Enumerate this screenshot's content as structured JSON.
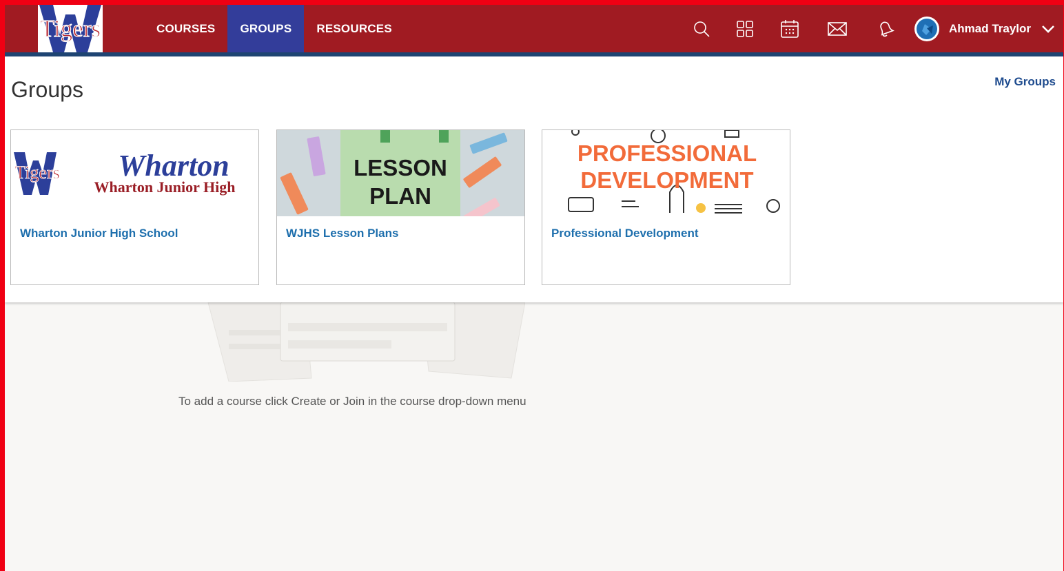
{
  "header": {
    "logo_text": "Tigers",
    "nav": [
      {
        "label": "COURSES"
      },
      {
        "label": "GROUPS",
        "active": true
      },
      {
        "label": "RESOURCES"
      }
    ],
    "icons": [
      "search-icon",
      "apps-grid-icon",
      "calendar-icon",
      "mail-icon",
      "bell-icon"
    ],
    "user_name": "Ahmad Traylor"
  },
  "page": {
    "title": "Groups",
    "my_groups_link": "My Groups"
  },
  "groups": [
    {
      "title": "Wharton Junior High School",
      "image_text": [
        "Tigers",
        "Wharton",
        "Wharton Junior High"
      ]
    },
    {
      "title": "WJHS Lesson Plans",
      "image_text": [
        "LESSON",
        "PLAN"
      ]
    },
    {
      "title": "Professional Development",
      "image_text": [
        "PROFESSIONAL",
        "DEVELOPMENT"
      ]
    }
  ],
  "empty_state": {
    "message": "To add a course click Create or Join in the course drop-down menu"
  },
  "colors": {
    "header_bg": "#a01b22",
    "active_nav": "#333d9a",
    "link": "#1e6fad",
    "frame_border": "#f00013"
  }
}
